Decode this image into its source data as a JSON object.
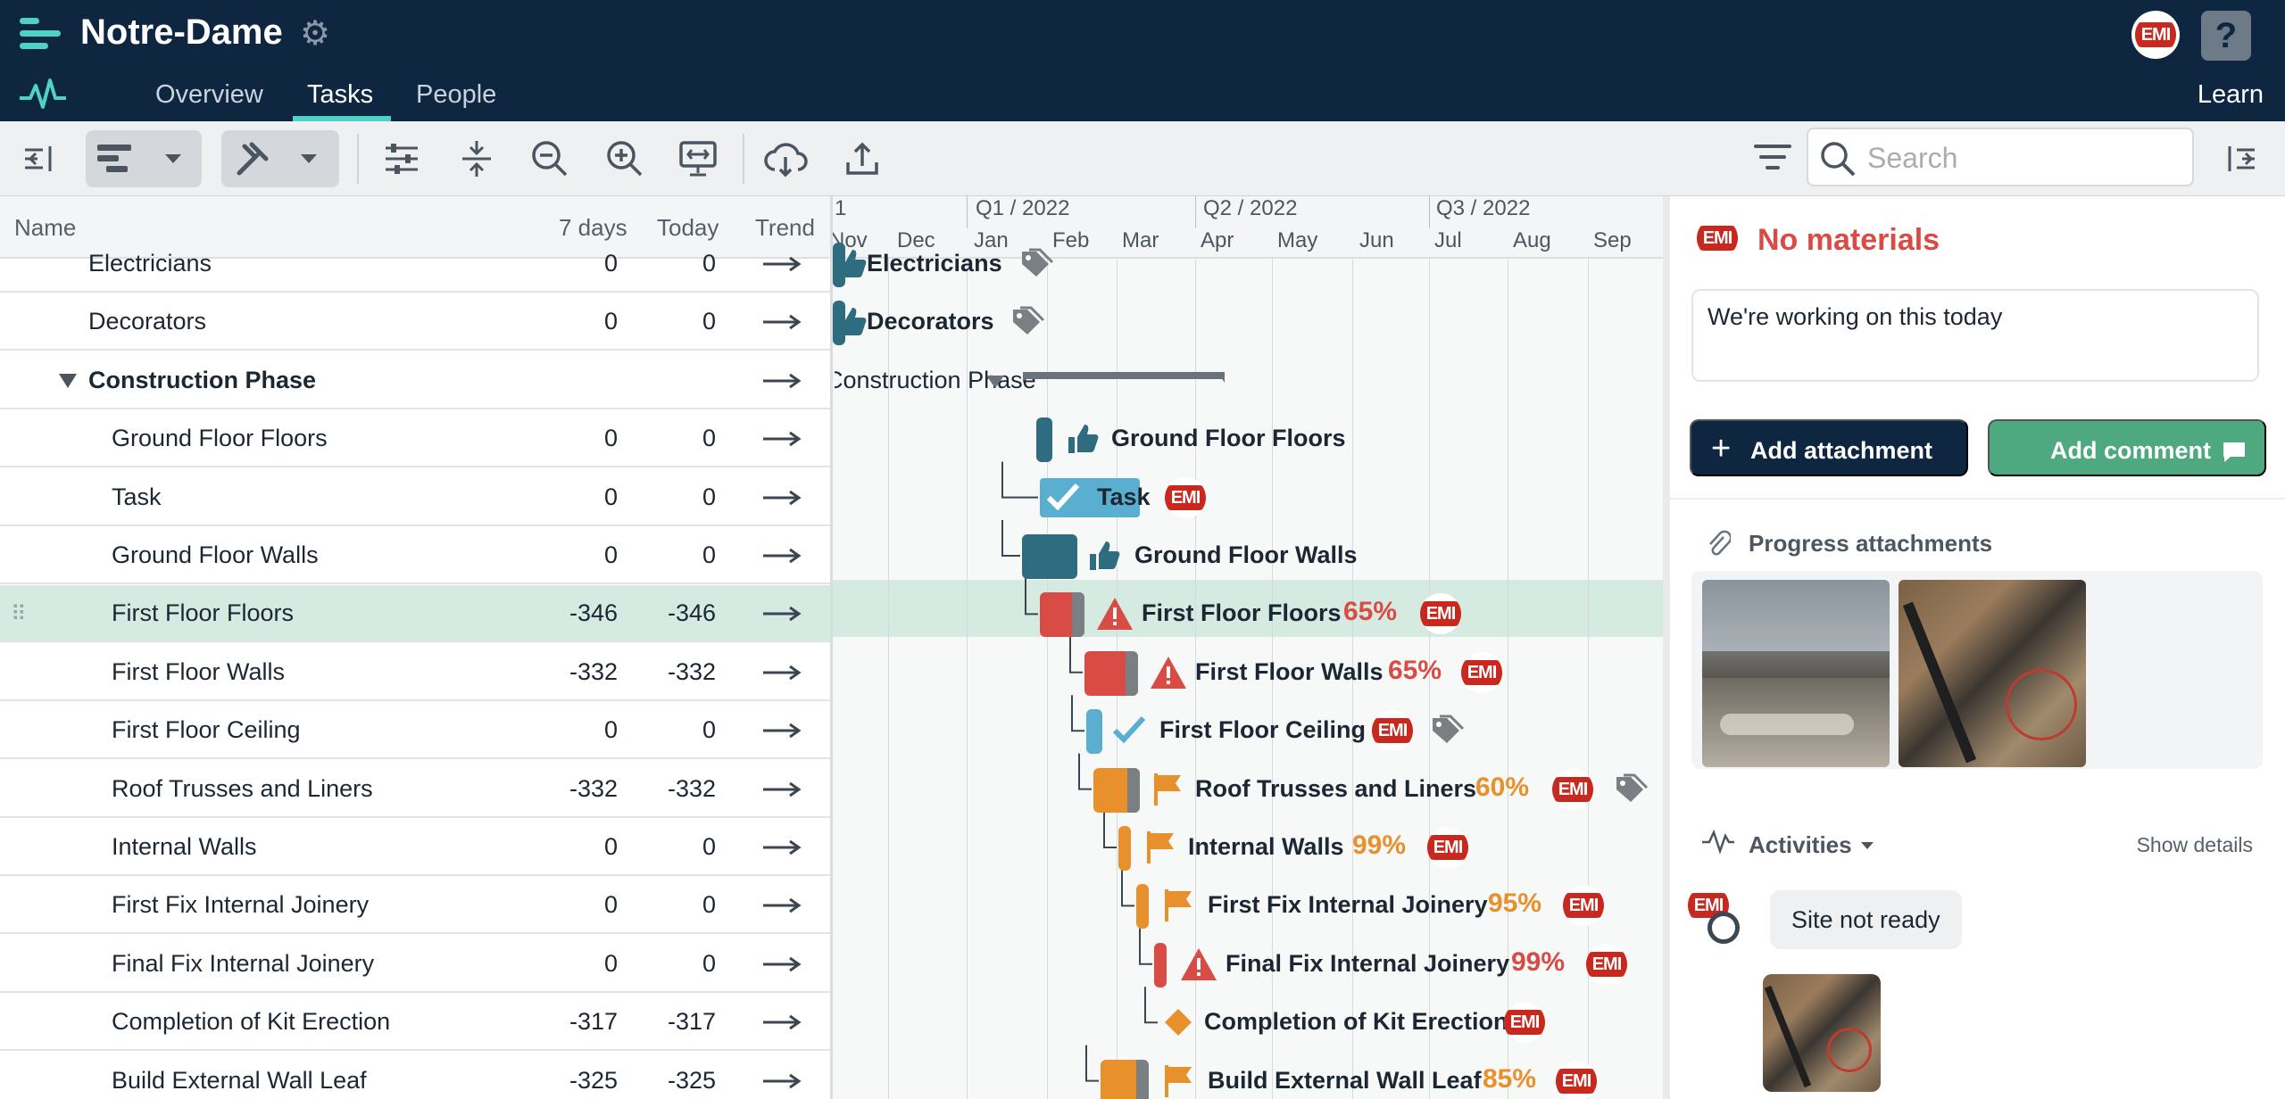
{
  "app": {
    "title": "Notre-Dame",
    "nav_tabs": [
      "Overview",
      "Tasks",
      "People"
    ],
    "active_tab": "Tasks",
    "learn_label": "Learn",
    "help_label": "?",
    "avatar_text": "EMI"
  },
  "toolbar": {
    "search_placeholder": "Search",
    "icons": [
      "collapse-left-icon",
      "bar-view-icon",
      "dropdown-icon",
      "tools-icon",
      "dropdown-icon",
      "sliders-icon",
      "fit-icon",
      "zoom-out-icon",
      "zoom-in-icon",
      "present-icon",
      "cloud-sync-icon",
      "upload-icon",
      "filter-icon",
      "search-icon",
      "collapse-right-icon"
    ]
  },
  "grid": {
    "columns": {
      "name": "Name",
      "d7": "7 days",
      "today": "Today",
      "trend": "Trend"
    },
    "rows": [
      {
        "name": "Electricians",
        "d7": "0",
        "today": "0",
        "indent": 1
      },
      {
        "name": "Decorators",
        "d7": "0",
        "today": "0",
        "indent": 1
      },
      {
        "name": "Construction Phase",
        "d7": "",
        "today": "",
        "indent": 1,
        "group": true
      },
      {
        "name": "Ground Floor Floors",
        "d7": "0",
        "today": "0",
        "indent": 2
      },
      {
        "name": "Task",
        "d7": "0",
        "today": "0",
        "indent": 2
      },
      {
        "name": "Ground Floor Walls",
        "d7": "0",
        "today": "0",
        "indent": 2
      },
      {
        "name": "First Floor Floors",
        "d7": "-346",
        "today": "-346",
        "indent": 2,
        "selected": true
      },
      {
        "name": "First Floor Walls",
        "d7": "-332",
        "today": "-332",
        "indent": 2
      },
      {
        "name": "First Floor Ceiling",
        "d7": "0",
        "today": "0",
        "indent": 2
      },
      {
        "name": "Roof Trusses and Liners",
        "d7": "-332",
        "today": "-332",
        "indent": 2
      },
      {
        "name": "Internal Walls",
        "d7": "0",
        "today": "0",
        "indent": 2
      },
      {
        "name": "First Fix Internal Joinery",
        "d7": "0",
        "today": "0",
        "indent": 2
      },
      {
        "name": "Final Fix Internal Joinery",
        "d7": "0",
        "today": "0",
        "indent": 2
      },
      {
        "name": "Completion of Kit Erection",
        "d7": "-317",
        "today": "-317",
        "indent": 2
      },
      {
        "name": "Build External Wall Leaf",
        "d7": "-325",
        "today": "-325",
        "indent": 2
      }
    ]
  },
  "gantt": {
    "quarters": [
      "1",
      "Q1 / 2022",
      "Q2 / 2022",
      "Q3 / 2022"
    ],
    "months": [
      "Nov",
      "Dec",
      "Jan",
      "Feb",
      "Mar",
      "Apr",
      "May",
      "Jun",
      "Jul",
      "Aug",
      "Sep"
    ],
    "bars": [
      {
        "label": "Electricians",
        "pct": "",
        "icon": "thumbs-up-icon"
      },
      {
        "label": "Decorators",
        "pct": "",
        "icon": "thumbs-up-icon"
      },
      {
        "label": "Construction Phase",
        "pct": "",
        "icon": ""
      },
      {
        "label": "Ground Floor Floors",
        "pct": "",
        "icon": "thumbs-up-icon"
      },
      {
        "label": "Task",
        "pct": "",
        "icon": "check-icon"
      },
      {
        "label": "Ground Floor Walls",
        "pct": "",
        "icon": "thumbs-up-icon"
      },
      {
        "label": "First Floor Floors",
        "pct": "65%",
        "icon": "warning-icon"
      },
      {
        "label": "First Floor Walls",
        "pct": "65%",
        "icon": "warning-icon"
      },
      {
        "label": "First Floor Ceiling",
        "pct": "",
        "icon": "check-icon"
      },
      {
        "label": "Roof Trusses and Liners",
        "pct": "60%",
        "icon": "flag-icon"
      },
      {
        "label": "Internal Walls",
        "pct": "99%",
        "icon": "flag-icon"
      },
      {
        "label": "First Fix Internal Joinery",
        "pct": "95%",
        "icon": "flag-icon"
      },
      {
        "label": "Final Fix Internal Joinery",
        "pct": "99%",
        "icon": "warning-icon"
      },
      {
        "label": "Completion of Kit Erection",
        "pct": "",
        "icon": "diamond-icon"
      },
      {
        "label": "Build External Wall Leaf",
        "pct": "85%",
        "icon": "flag-icon"
      }
    ]
  },
  "details": {
    "no_materials": "No materials",
    "note_text": "We're working on this today",
    "add_attachment": "Add attachment",
    "add_comment": "Add comment",
    "progress_attachments": "Progress attachments",
    "activities": "Activities",
    "show_details": "Show details",
    "activity_message": "Site not ready"
  },
  "colors": {
    "header_bg": "#0f2641",
    "accent": "#4fd1c5",
    "selected_row": "#d5ebe2",
    "danger": "#d94b45",
    "warning": "#e8902c",
    "comment_btn": "#4ea880",
    "bar_teal": "#2e6c80",
    "bar_light": "#5aaed0"
  }
}
